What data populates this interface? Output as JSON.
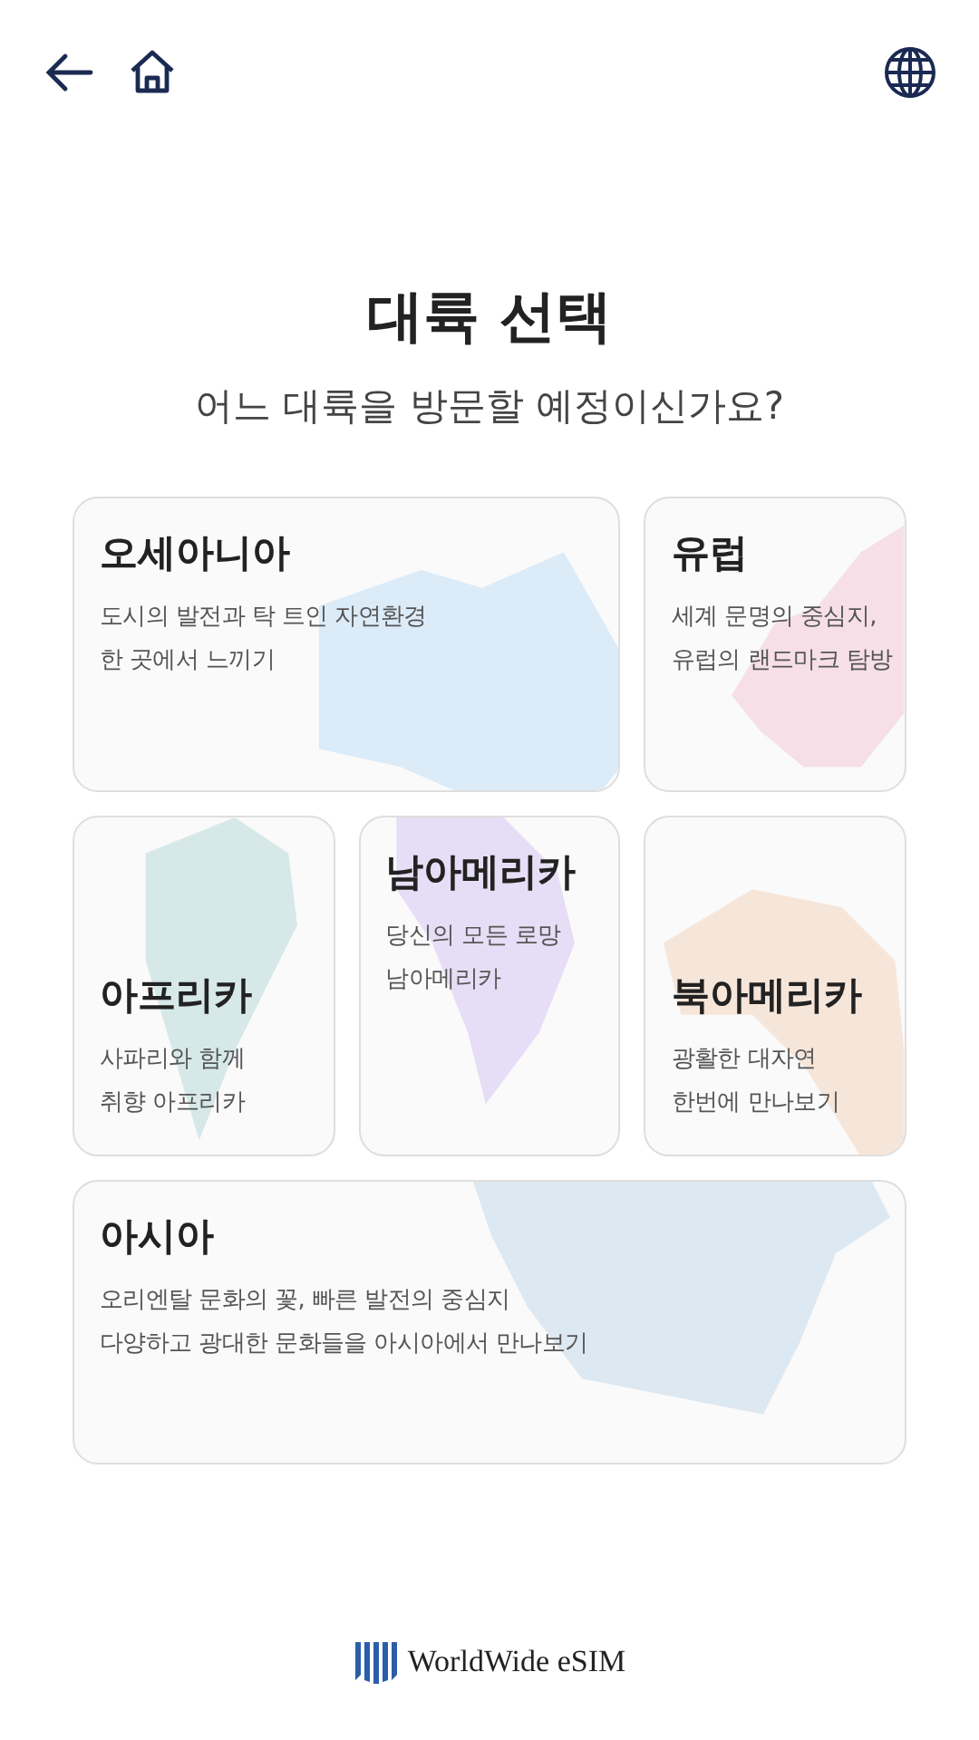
{
  "title": "대륙 선택",
  "subtitle": "어느 대륙을 방문할 예정이신가요?",
  "continents": [
    {
      "name": "오세아니아",
      "description": [
        "도시의 발전과 탁 트인 자연환경",
        "한 곳에서 느끼기"
      ],
      "color": "#dcebf8"
    },
    {
      "name": "유럽",
      "description": [
        "세계 문명의 중심지,",
        "유럽의 랜드마크 탐방"
      ],
      "color": "#f6dfe6"
    },
    {
      "name": "아프리카",
      "description": [
        "사파리와 함께",
        "취향 아프리카"
      ],
      "color": "#d6e9e8"
    },
    {
      "name": "남아메리카",
      "description": [
        "당신의 모든 로망",
        "남아메리카"
      ],
      "color": "#e6def6"
    },
    {
      "name": "북아메리카",
      "description": [
        "광활한 대자연",
        "한번에 만나보기"
      ],
      "color": "#f6e6da"
    },
    {
      "name": "아시아",
      "description": [
        "오리엔탈 문화의 꽃, 빠른 발전의 중심지",
        "다양하고 광대한 문화들을 아시아에서 만나보기"
      ],
      "color": "#dce8f2"
    }
  ],
  "brand": "WorldWide eSIM"
}
